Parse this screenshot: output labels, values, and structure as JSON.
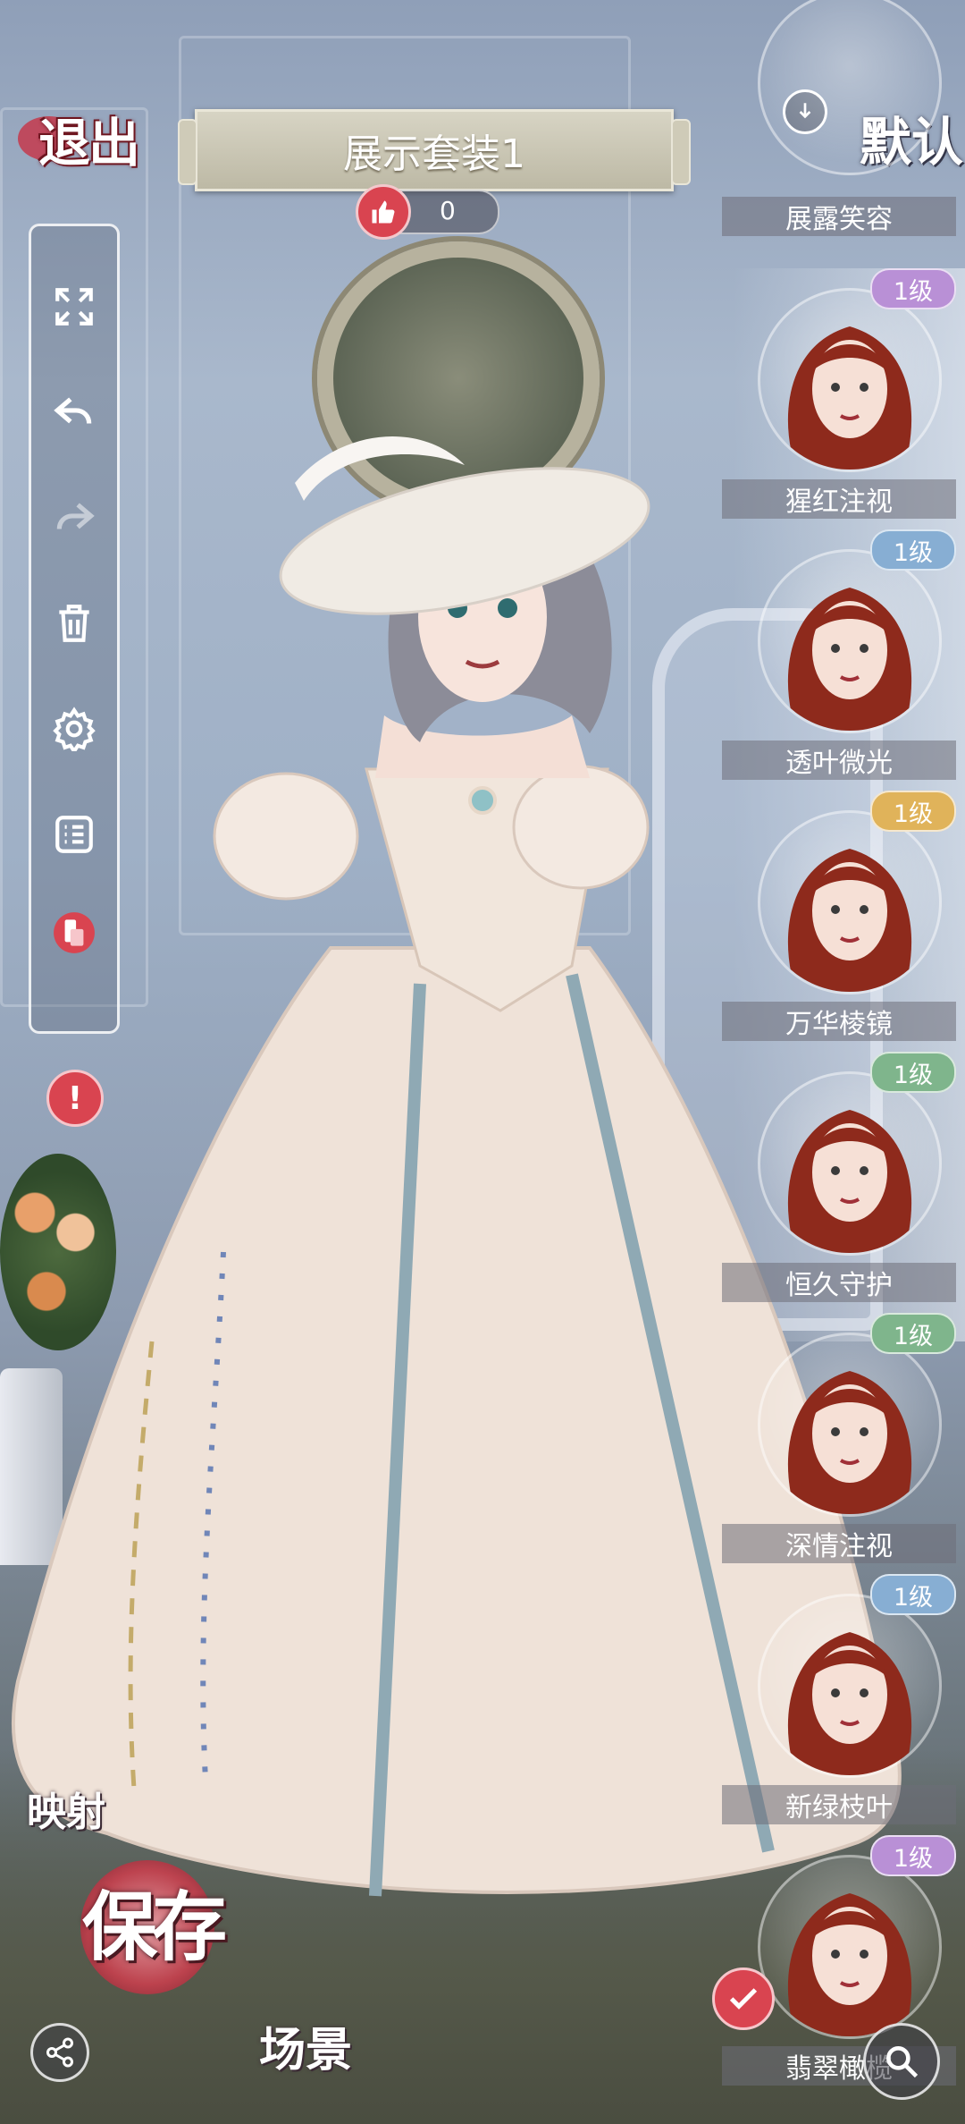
{
  "header": {
    "exit_label": "退出",
    "outfit_title": "展示套装1",
    "like_count": "0"
  },
  "right_panel": {
    "default_label": "默认",
    "top_partial_item": "展露笑容",
    "items": [
      {
        "name": "猩红注视",
        "level": "1级",
        "level_color": "#b990d6"
      },
      {
        "name": "透叶微光",
        "level": "1级",
        "level_color": "#87aed3"
      },
      {
        "name": "万华棱镜",
        "level": "1级",
        "level_color": "#e0b35a"
      },
      {
        "name": "恒久守护",
        "level": "1级",
        "level_color": "#7fb58c"
      },
      {
        "name": "深情注视",
        "level": "1级",
        "level_color": "#7fb58c"
      },
      {
        "name": "新绿枝叶",
        "level": "1级",
        "level_color": "#87aed3"
      },
      {
        "name": "翡翠橄榄",
        "level": "1级",
        "level_color": "#b990d6"
      }
    ]
  },
  "bottom": {
    "map_label": "映射",
    "save_label": "保存",
    "scene_label": "场景"
  },
  "icons": [
    "fullscreen-icon",
    "undo-icon",
    "redo-icon",
    "trash-icon",
    "settings-icon",
    "list-icon",
    "phone-rotate-icon",
    "alert-icon",
    "thumbs-up-icon",
    "filter-icon",
    "check-icon",
    "search-icon",
    "share-icon"
  ],
  "colors": {
    "accent_red": "#d94450",
    "plate": "#c8c4b2",
    "hair": "#8e2a1c"
  }
}
